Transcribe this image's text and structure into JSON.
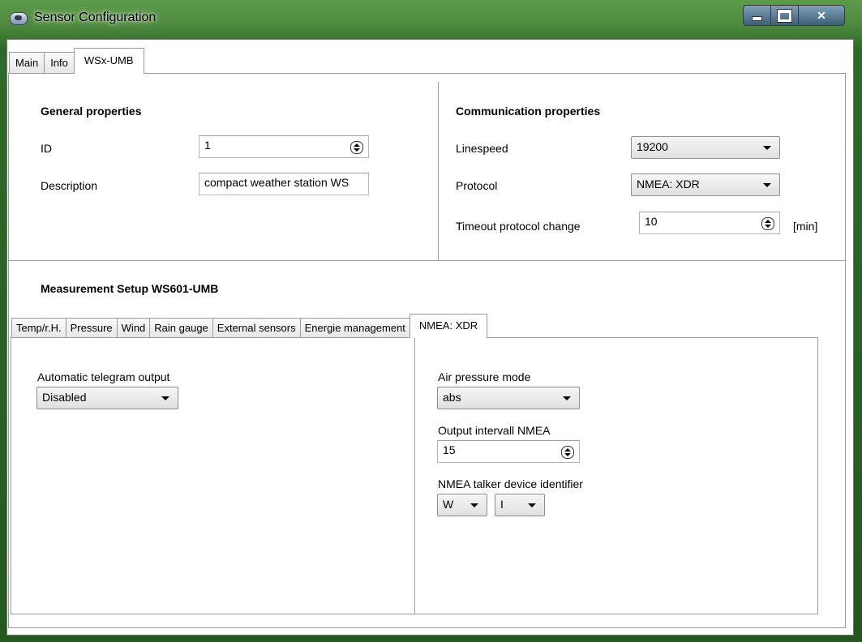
{
  "window": {
    "title": "Sensor Configuration"
  },
  "tabs": [
    {
      "label": "Main"
    },
    {
      "label": "Info"
    },
    {
      "label": "WSx-UMB",
      "active": true
    }
  ],
  "general": {
    "title": "General properties",
    "id_label": "ID",
    "id_value": "1",
    "description_label": "Description",
    "description_value": "compact weather station WS"
  },
  "communication": {
    "title": "Communication properties",
    "linespeed_label": "Linespeed",
    "linespeed_value": "19200",
    "protocol_label": "Protocol",
    "protocol_value": "NMEA: XDR",
    "timeout_label": "Timeout protocol change",
    "timeout_value": "10",
    "timeout_unit": "[min]"
  },
  "measurement": {
    "title": "Measurement Setup  WS601-UMB",
    "tabs": [
      {
        "label": "Temp/r.H."
      },
      {
        "label": "Pressure"
      },
      {
        "label": "Wind"
      },
      {
        "label": "Rain gauge"
      },
      {
        "label": "External sensors"
      },
      {
        "label": "Energie management"
      },
      {
        "label": "NMEA: XDR",
        "active": true
      }
    ],
    "auto_output_label": "Automatic telegram output",
    "auto_output_value": "Disabled",
    "air_pressure_label": "Air pressure mode",
    "air_pressure_value": "abs",
    "output_interval_label": "Output intervall NMEA",
    "output_interval_value": "15",
    "talker_label": "NMEA talker device identifier",
    "talker_value_1": "W",
    "talker_value_2": "I"
  },
  "icons": [
    "app-icon",
    "minimize-icon",
    "maximize-icon",
    "close-icon",
    "spinner-icon",
    "dropdown-arrow-icon"
  ]
}
